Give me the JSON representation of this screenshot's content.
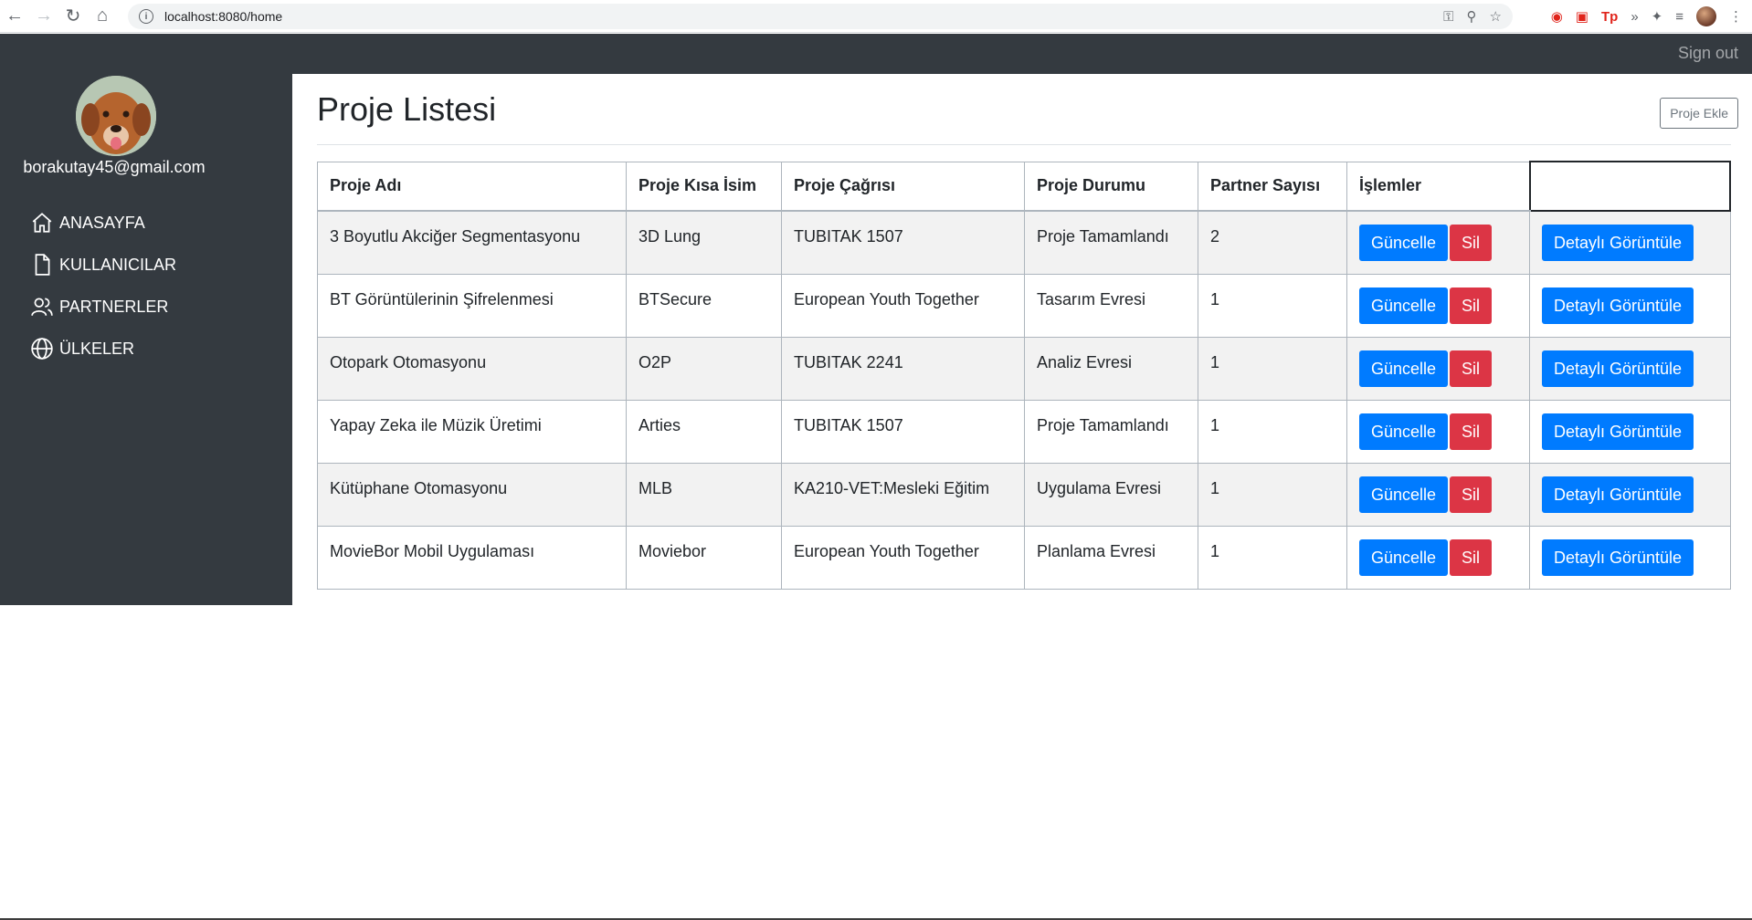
{
  "browser": {
    "url": "localhost:8080/home"
  },
  "topbar": {
    "signout_label": "Sign out"
  },
  "sidebar": {
    "email": "borakutay45@gmail.com",
    "items": [
      {
        "label": "ANASAYFA",
        "icon": "home-icon"
      },
      {
        "label": "KULLANICILAR",
        "icon": "file-icon"
      },
      {
        "label": "PARTNERLER",
        "icon": "users-icon"
      },
      {
        "label": "ÜLKELER",
        "icon": "globe-icon"
      }
    ]
  },
  "main": {
    "title": "Proje Listesi",
    "add_button": "Proje Ekle",
    "columns": [
      "Proje Adı",
      "Proje Kısa İsim",
      "Proje Çağrısı",
      "Proje Durumu",
      "Partner Sayısı",
      "İşlemler",
      ""
    ],
    "rows": [
      {
        "name": "3 Boyutlu Akciğer Segmentasyonu",
        "short": "3D Lung",
        "call": "TUBITAK 1507",
        "status": "Proje Tamamlandı",
        "partners": "2"
      },
      {
        "name": "BT Görüntülerinin Şifrelenmesi",
        "short": "BTSecure",
        "call": "European Youth Together",
        "status": "Tasarım Evresi",
        "partners": "1"
      },
      {
        "name": "Otopark Otomasyonu",
        "short": "O2P",
        "call": "TUBITAK 2241",
        "status": "Analiz Evresi",
        "partners": "1"
      },
      {
        "name": "Yapay Zeka ile Müzik Üretimi",
        "short": "Arties",
        "call": "TUBITAK 1507",
        "status": "Proje Tamamlandı",
        "partners": "1"
      },
      {
        "name": "Kütüphane Otomasyonu",
        "short": "MLB",
        "call": "KA210-VET:Mesleki Eğitim",
        "status": "Uygulama Evresi",
        "partners": "1"
      },
      {
        "name": "MovieBor Mobil Uygulaması",
        "short": "Moviebor",
        "call": "European Youth Together",
        "status": "Planlama Evresi",
        "partners": "1"
      }
    ],
    "update_label": "Güncelle",
    "delete_label": "Sil",
    "detail_label": "Detaylı Görüntüle"
  },
  "colors": {
    "sidebar_bg": "#343a40",
    "primary": "#007bff",
    "danger": "#dc3545"
  }
}
